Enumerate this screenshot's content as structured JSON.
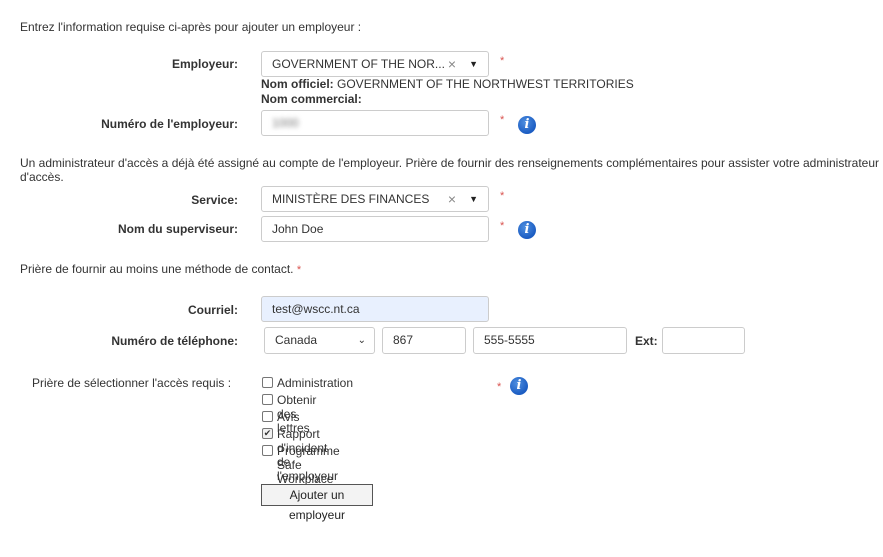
{
  "intro": "Entrez l'information requise ci-après pour ajouter un employeur :",
  "required_mark": "*",
  "info_glyph": "i",
  "employer": {
    "label": "Employeur:",
    "value": "GOVERNMENT OF THE NOR...",
    "clear": "×",
    "arrow": "▼",
    "official_label": "Nom officiel:",
    "official_value": "GOVERNMENT OF THE NORTHWEST TERRITORIES",
    "commercial_label": "Nom commercial:"
  },
  "employer_number": {
    "label": "Numéro de l'employeur:",
    "value": "1000"
  },
  "admin_note": "Un administrateur d'accès a déjà été assigné au compte de l'employeur. Prière de fournir des renseignements complémentaires pour assister votre administrateur d'accès.",
  "service": {
    "label": "Service:",
    "value": "MINISTÈRE DES FINANCES",
    "clear": "×",
    "arrow": "▼"
  },
  "supervisor": {
    "label": "Nom du superviseur:",
    "value": "John Doe"
  },
  "contact_note": "Prière de fournir au moins une méthode de contact.",
  "email": {
    "label": "Courriel:",
    "value": "test@wscc.nt.ca"
  },
  "phone": {
    "label": "Numéro de téléphone:",
    "country": "Canada",
    "area_code": "867",
    "number": "555-5555",
    "ext_label": "Ext:",
    "ext_value": ""
  },
  "access": {
    "label": "Prière de sélectionner l'accès requis :",
    "options": [
      {
        "label": "Administration",
        "checked": false
      },
      {
        "label": "Obtenir des lettres",
        "checked": false
      },
      {
        "label": "Avis",
        "checked": false
      },
      {
        "label": "Rapport d'incident de l'employeur",
        "checked": true
      },
      {
        "label": "Programme Safe Workplace",
        "checked": false
      }
    ],
    "check_glyph": "✔"
  },
  "submit_label": "Ajouter un employeur",
  "colors": {
    "required": "#d9534f",
    "email_bg": "#e8f0fe",
    "info_icon": "#1b5cc2"
  }
}
